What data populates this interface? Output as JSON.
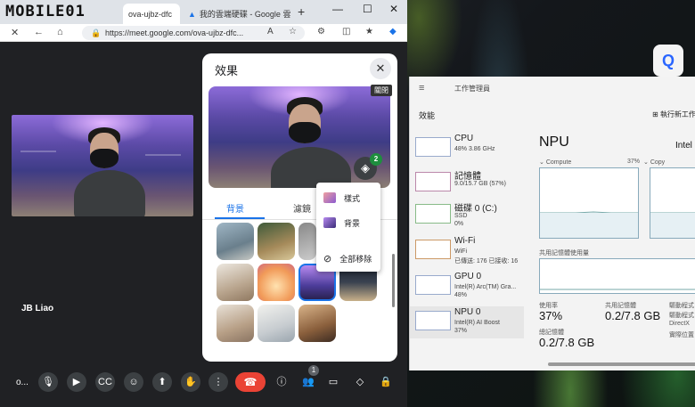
{
  "watermark": "MOBILE01",
  "browser": {
    "tabs": [
      {
        "label": "ova-ujbz-dfc",
        "active": true
      },
      {
        "label": "我的雲端硬碟 - Google 雲",
        "active": false
      }
    ],
    "url": "https://meet.google.com/ova-ujbz-dfc..."
  },
  "meet": {
    "participant_name": "JB Liao",
    "participant_badge": "1",
    "left_dots": "o..."
  },
  "effects": {
    "title": "效果",
    "close_label": "✕",
    "preview_off_label": "關閉",
    "style_badge": "2",
    "tabs": [
      "背景",
      "濾鏡"
    ],
    "menu": [
      {
        "label": "樣式"
      },
      {
        "label": "背景"
      },
      {
        "label": "全部移除"
      }
    ]
  },
  "taskmanager": {
    "title": "工作管理員",
    "section": "效能",
    "new_task": "執行新工作",
    "items": [
      {
        "name": "CPU",
        "sub": "48% 3.86 GHz"
      },
      {
        "name": "記憶體",
        "sub": "9.0/15.7 GB (57%)"
      },
      {
        "name": "磁碟 0 (C:)",
        "sub": "SSD",
        "sub2": "0%"
      },
      {
        "name": "Wi-Fi",
        "sub": "WiFi",
        "sub2": "已傳送: 176 已接收: 16"
      },
      {
        "name": "GPU 0",
        "sub": "Intel(R) Arc(TM) Gra...",
        "sub2": "48%"
      },
      {
        "name": "NPU 0",
        "sub": "Intel(R) AI Boost",
        "sub2": "37%"
      }
    ],
    "npu": {
      "title": "NPU",
      "device": "Intel",
      "compute_label": "Compute",
      "compute_pct": "37%",
      "copy_label": "Copy",
      "shared_mem_label": "共用記憶體使用量",
      "usage_label": "使用率",
      "usage_value": "37%",
      "shared_label": "共用記憶體",
      "shared_value": "0.2/7.8 GB",
      "total_label": "總記憶體",
      "total_value": "0.2/7.8 GB",
      "right_labels": [
        "驅動程式",
        "驅動程式",
        "DirectX",
        "實際位置"
      ]
    }
  }
}
